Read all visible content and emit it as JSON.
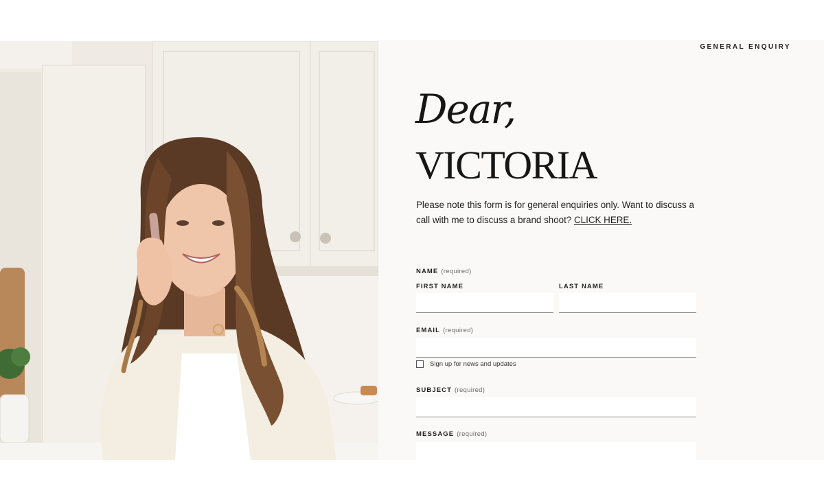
{
  "header": {
    "label": "GENERAL ENQUIRY"
  },
  "hero": {
    "greeting": "Dear,",
    "name": "VICTORIA",
    "intro_text": "Please note this form is for general enquiries only. Want to discuss a call with me to discuss a brand shoot? ",
    "intro_link": "CLICK HERE."
  },
  "photo": {
    "description_icon": "portrait-photo"
  },
  "form": {
    "name_label": "NAME",
    "name_required": "(required)",
    "first_name_label": "FIRST NAME",
    "last_name_label": "LAST NAME",
    "first_name_value": "",
    "last_name_value": "",
    "email_label": "EMAIL",
    "email_required": "(required)",
    "email_value": "",
    "newsletter_label": "Sign up for news and updates",
    "newsletter_checked": false,
    "subject_label": "SUBJECT",
    "subject_required": "(required)",
    "subject_value": "",
    "message_label": "MESSAGE",
    "message_required": "(required)",
    "message_value": ""
  },
  "colors": {
    "panel_bg": "#faf9f7",
    "text": "#1f1f1f",
    "field_border": "#8a8a8a"
  }
}
